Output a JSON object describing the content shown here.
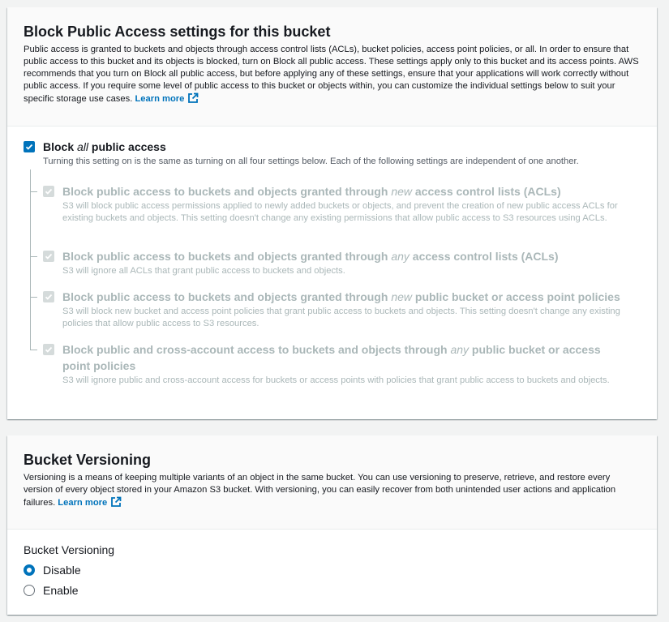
{
  "block_public_access": {
    "title": "Block Public Access settings for this bucket",
    "description": "Public access is granted to buckets and objects through access control lists (ACLs), bucket policies, access point policies, or all. In order to ensure that public access to this bucket and its objects is blocked, turn on Block all public access. These settings apply only to this bucket and its access points. AWS recommends that you turn on Block all public access, but before applying any of these settings, ensure that your applications will work correctly without public access. If you require some level of public access to this bucket or objects within, you can customize the individual settings below to suit your specific storage use cases.",
    "learn_more": "Learn more",
    "master": {
      "label_pre": "Block ",
      "label_em": "all",
      "label_post": " public access",
      "checked": true,
      "description": "Turning this setting on is the same as turning on all four settings below. Each of the following settings are independent of one another."
    },
    "options": [
      {
        "title_pre": "Block public access to buckets and objects granted through ",
        "title_em": "new",
        "title_post": " access control lists (ACLs)",
        "description": "S3 will block public access permissions applied to newly added buckets or objects, and prevent the creation of new public access ACLs for existing buckets and objects. This setting doesn't change any existing permissions that allow public access to S3 resources using ACLs.",
        "checked": true
      },
      {
        "title_pre": "Block public access to buckets and objects granted through ",
        "title_em": "any",
        "title_post": " access control lists (ACLs)",
        "description": "S3 will ignore all ACLs that grant public access to buckets and objects.",
        "checked": true
      },
      {
        "title_pre": "Block public access to buckets and objects granted through ",
        "title_em": "new",
        "title_post": " public bucket or access point policies",
        "description": "S3 will block new bucket and access point policies that grant public access to buckets and objects. This setting doesn't change any existing policies that allow public access to S3 resources.",
        "checked": true
      },
      {
        "title_pre": "Block public and cross-account access to buckets and objects through ",
        "title_em": "any",
        "title_post": " public bucket or access point policies",
        "description": "S3 will ignore public and cross-account access for buckets or access points with policies that grant public access to buckets and objects.",
        "checked": true
      }
    ]
  },
  "versioning": {
    "title": "Bucket Versioning",
    "description": "Versioning is a means of keeping multiple variants of an object in the same bucket. You can use versioning to preserve, retrieve, and restore every version of every object stored in your Amazon S3 bucket. With versioning, you can easily recover from both unintended user actions and application failures.",
    "learn_more": "Learn more",
    "field_label": "Bucket Versioning",
    "options": [
      {
        "label": "Disable",
        "selected": true
      },
      {
        "label": "Enable",
        "selected": false
      }
    ]
  },
  "icons": {
    "checkbox_check": "check-icon",
    "external_link": "external-link-icon"
  },
  "colors": {
    "accent": "#0073bb",
    "disabled": "#aab7b8",
    "disabled_check_bg": "#d5dbdb",
    "text": "#16191f",
    "secondary_text": "#545b64",
    "header_bg": "#fafafa",
    "page_bg": "#f2f3f3"
  }
}
